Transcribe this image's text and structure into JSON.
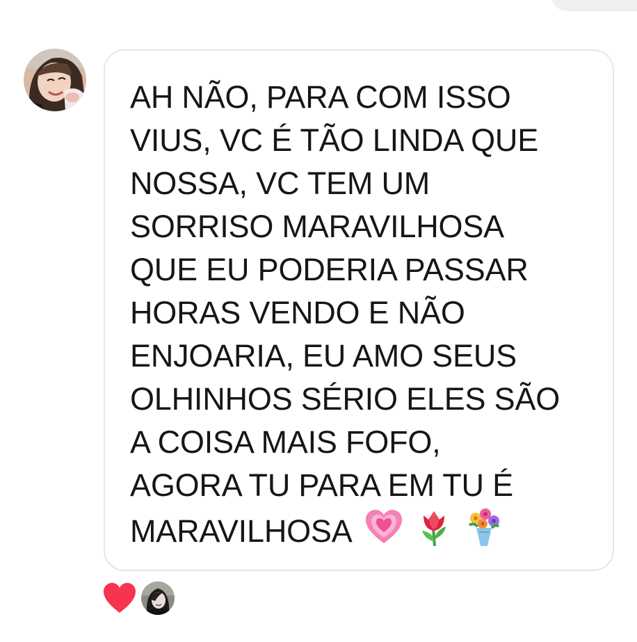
{
  "message": {
    "lines": [
      "AH NÃO, PARA COM ISSO",
      "VIUS, VC É TÃO LINDA QUE",
      "NOSSA, VC TEM UM",
      "SORRISO MARAVILHOSA",
      "QUE EU PODERIA PASSAR",
      "HORAS VENDO E NÃO",
      "ENJOARIA, EU AMO SEUS",
      "OLHINHOS SÉRIO ELES SÃO",
      "A COISA MAIS FOFO,",
      "AGORA TU PARA EM TU É",
      "MARAVILHOSA"
    ],
    "emojis": [
      "growing-heart",
      "tulip",
      "bouquet"
    ]
  },
  "sender": {
    "avatar_icon": "user-avatar-photo"
  },
  "reactions": {
    "emoji": "red-heart",
    "reactor_avatar_icon": "reactor-avatar-photo"
  },
  "colors": {
    "bubble_border": "#e6e6e6",
    "text": "#161616",
    "heart": "#f7334f",
    "background": "#ffffff"
  }
}
